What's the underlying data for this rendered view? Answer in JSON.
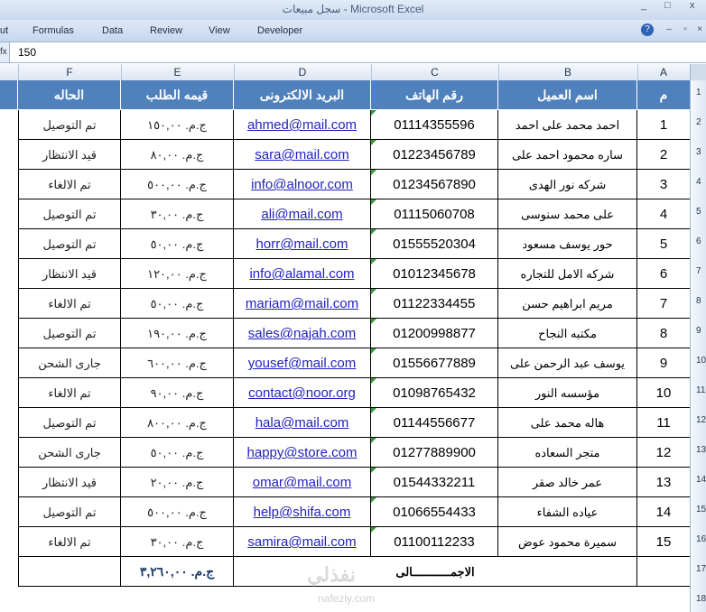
{
  "window": {
    "title": "سجل مبيعات - Microsoft Excel",
    "min": "_",
    "max": "□",
    "close": "x"
  },
  "ribbon": {
    "tabs": [
      "ut",
      "Formulas",
      "Data",
      "Review",
      "View",
      "Developer"
    ]
  },
  "formula_bar": {
    "fx": "fx",
    "value": "150"
  },
  "columns": [
    "F",
    "E",
    "D",
    "C",
    "B",
    "A"
  ],
  "row_numbers": [
    "1",
    "2",
    "3",
    "4",
    "5",
    "6",
    "7",
    "8",
    "9",
    "10",
    "11",
    "12",
    "13",
    "14",
    "15",
    "16",
    "17",
    "18"
  ],
  "headers": {
    "num": "م",
    "name": "اسم العميل",
    "phone": "رقم الهاتف",
    "email": "البريد الالكترونى",
    "value": "قيمه الطلب",
    "status": "الحاله"
  },
  "rows": [
    {
      "num": "1",
      "name": "احمد محمد على احمد",
      "phone": "01114355596",
      "email": "ahmed@mail.com",
      "value": "ج.م. ١٥٠,٠٠",
      "status": "تم التوصيل"
    },
    {
      "num": "2",
      "name": "ساره محمود احمد على",
      "phone": "01223456789",
      "email": "sara@mail.com",
      "value": "ج.م. ٨٠,٠٠",
      "status": "قيد الانتظار"
    },
    {
      "num": "3",
      "name": "شركه نور الهدى",
      "phone": "01234567890",
      "email": "info@alnoor.com",
      "value": "ج.م. ٥٠٠,٠٠",
      "status": "تم الالغاء"
    },
    {
      "num": "4",
      "name": "على محمد سنوسى",
      "phone": "01115060708",
      "email": "ali@mail.com",
      "value": "ج.م. ٣٠,٠٠",
      "status": "تم التوصيل"
    },
    {
      "num": "5",
      "name": "حور يوسف مسعود",
      "phone": "01555520304",
      "email": "horr@mail.com",
      "value": "ج.م. ٥٠,٠٠",
      "status": "تم التوصيل"
    },
    {
      "num": "6",
      "name": "شركه الامل للتجاره",
      "phone": "01012345678",
      "email": "info@alamal.com",
      "value": "ج.م. ١٢٠,٠٠",
      "status": "قيد الانتظار"
    },
    {
      "num": "7",
      "name": "مريم ابراهيم حسن",
      "phone": "01122334455",
      "email": "mariam@mail.com",
      "value": "ج.م. ٥٠,٠٠",
      "status": "تم الالغاء"
    },
    {
      "num": "8",
      "name": "مكتبه النجاح",
      "phone": "01200998877",
      "email": "sales@najah.com",
      "value": "ج.م. ١٩٠,٠٠",
      "status": "تم التوصيل"
    },
    {
      "num": "9",
      "name": "يوسف عبد الرحمن على",
      "phone": "01556677889",
      "email": "yousef@mail.com",
      "value": "ج.م. ٦٠٠,٠٠",
      "status": "جارى الشحن"
    },
    {
      "num": "10",
      "name": "مؤسسه النور",
      "phone": "01098765432",
      "email": "contact@noor.org",
      "value": "ج.م. ٩٠,٠٠",
      "status": "تم الالغاء"
    },
    {
      "num": "11",
      "name": "هاله محمد على",
      "phone": "01144556677",
      "email": "hala@mail.com",
      "value": "ج.م. ٨٠٠,٠٠",
      "status": "تم التوصيل"
    },
    {
      "num": "12",
      "name": "متجر السعاده",
      "phone": "01277889900",
      "email": "happy@store.com",
      "value": "ج.م. ٥٠,٠٠",
      "status": "جارى الشحن"
    },
    {
      "num": "13",
      "name": "عمر خالد صقر",
      "phone": "01544332211",
      "email": "omar@mail.com",
      "value": "ج.م. ٢٠,٠٠",
      "status": "قيد الانتظار"
    },
    {
      "num": "14",
      "name": "عياده الشفاء",
      "phone": "01066554433",
      "email": "help@shifa.com",
      "value": "ج.م. ٥٠٠,٠٠",
      "status": "تم التوصيل"
    },
    {
      "num": "15",
      "name": "سميرة محمود عوض",
      "phone": "01100112233",
      "email": "samira@mail.com",
      "value": "ج.م. ٣٠,٠٠",
      "status": "تم الالغاء"
    }
  ],
  "total": {
    "label": "الاجمـــــــــــالى",
    "value": "ج.م. ٣,٢٦٠,٠٠"
  },
  "watermark": {
    "arabic": "نفذلي",
    "latin": "nafezly.com"
  },
  "colors": {
    "header_bg": "#4f81bd",
    "link": "#1f1fbf"
  }
}
